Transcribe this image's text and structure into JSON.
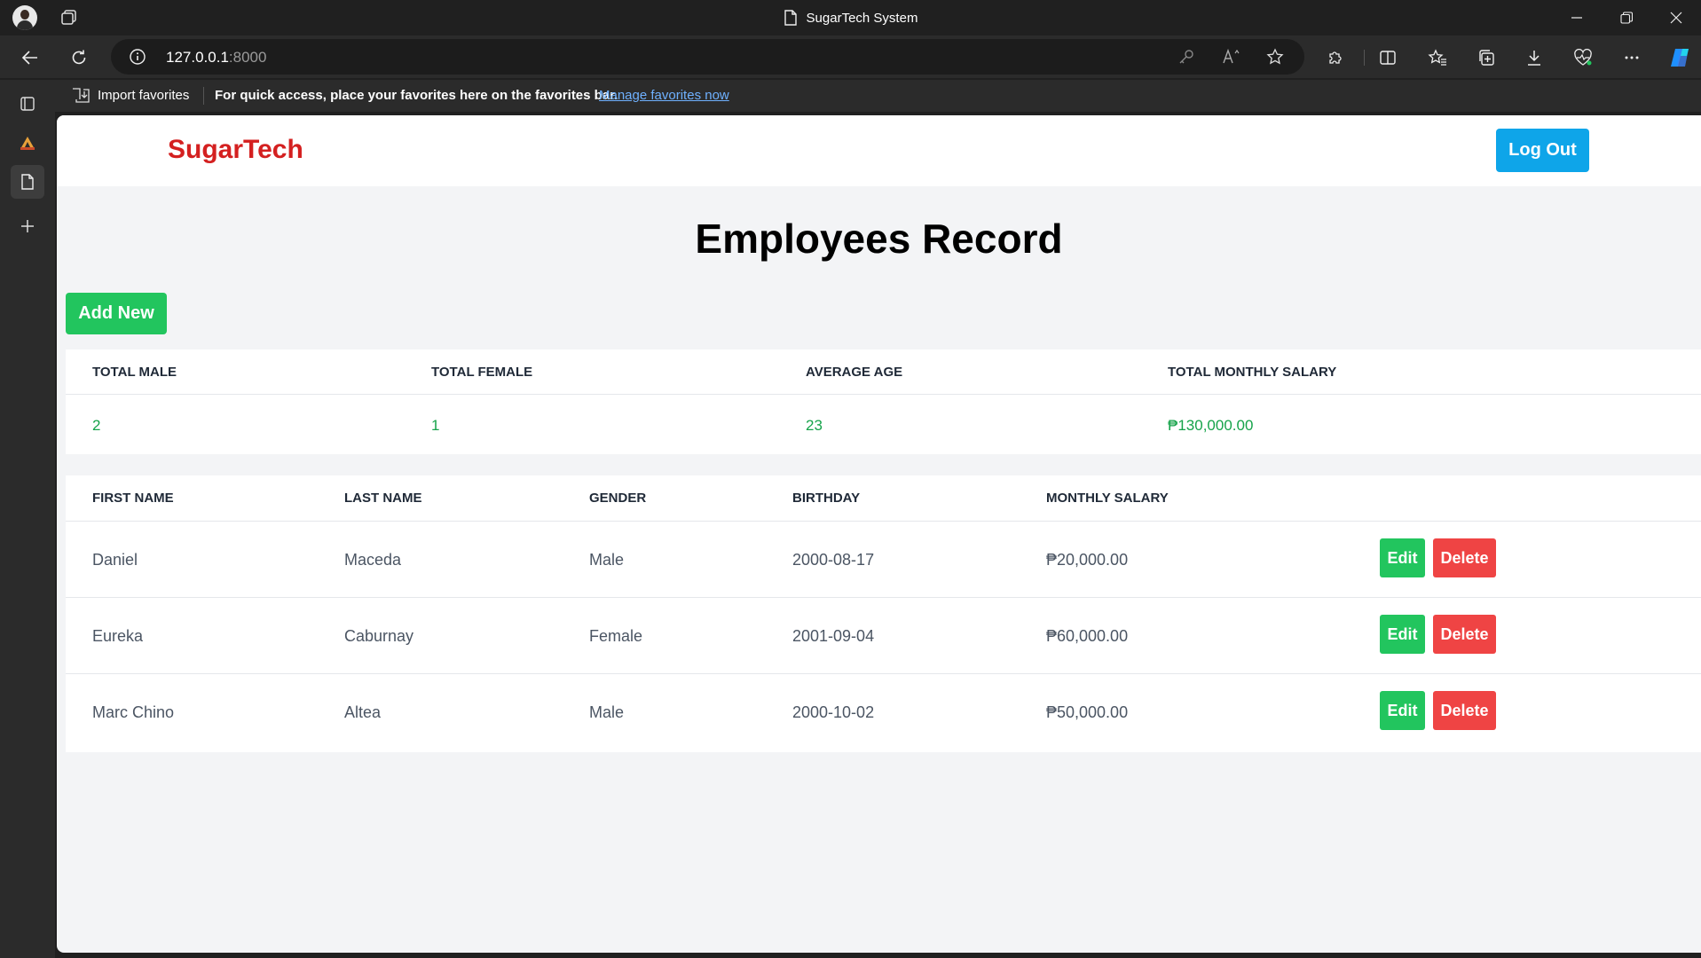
{
  "browser": {
    "window_title": "SugarTech System",
    "url_host": "127.0.0.1",
    "url_port": ":8000",
    "favorites_bar": {
      "import_label": "Import favorites",
      "message": "For quick access, place your favorites here on the favorites bar.",
      "manage_link": "Manage favorites now"
    }
  },
  "app": {
    "brand": "SugarTech",
    "logout_label": "Log Out",
    "page_title": "Employees Record",
    "add_new_label": "Add New",
    "summary": {
      "headers": [
        "TOTAL MALE",
        "TOTAL FEMALE",
        "AVERAGE AGE",
        "TOTAL MONTHLY SALARY"
      ],
      "values": [
        "2",
        "1",
        "23",
        "₱130,000.00"
      ]
    },
    "table": {
      "headers": [
        "FIRST NAME",
        "LAST NAME",
        "GENDER",
        "BIRTHDAY",
        "MONTHLY SALARY"
      ],
      "edit_label": "Edit",
      "delete_label": "Delete",
      "rows": [
        {
          "first_name": "Daniel",
          "last_name": "Maceda",
          "gender": "Male",
          "birthday": "2000-08-17",
          "salary": "₱20,000.00"
        },
        {
          "first_name": "Eureka",
          "last_name": "Caburnay",
          "gender": "Female",
          "birthday": "2001-09-04",
          "salary": "₱60,000.00"
        },
        {
          "first_name": "Marc Chino",
          "last_name": "Altea",
          "gender": "Male",
          "birthday": "2000-10-02",
          "salary": "₱50,000.00"
        }
      ]
    }
  },
  "colors": {
    "brand": "#d42020",
    "logout": "#0ea5e9",
    "add_new": "#22c55e",
    "edit": "#22c55e",
    "delete": "#ef4444",
    "summary_value": "#16a34a"
  }
}
